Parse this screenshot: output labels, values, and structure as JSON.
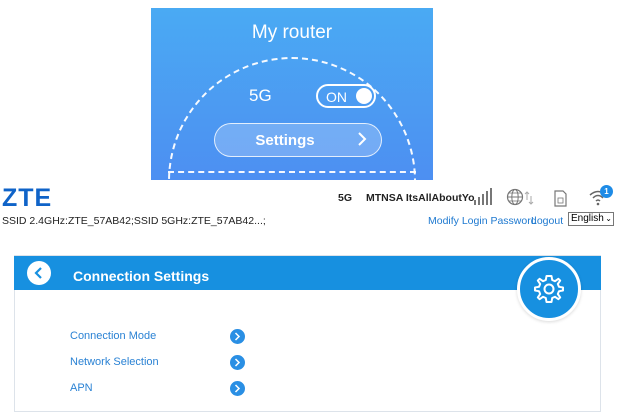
{
  "router": {
    "title": "My router",
    "band": "5G",
    "toggle_label": "ON",
    "settings_label": "Settings"
  },
  "header": {
    "logo": "ZTE",
    "ssid_text": "SSID 2.4GHz:ZTE_57AB42;SSID 5GHz:ZTE_57AB42...;",
    "network_type": "5G",
    "operator": "MTNSA ItsAllAboutYo",
    "wifi_clients": "1",
    "modify_login_label": "Modify Login Password",
    "logout_label": "Logout",
    "language": "English",
    "icons": [
      "signal-icon",
      "globe-icon",
      "sim-icon",
      "wifi-icon"
    ]
  },
  "panel": {
    "title": "Connection Settings",
    "items": [
      {
        "label": "Connection Mode"
      },
      {
        "label": "Network Selection"
      },
      {
        "label": "APN"
      }
    ]
  },
  "colors": {
    "accent": "#1790e0",
    "link": "#1e79d0",
    "logo": "#0f63c8"
  }
}
